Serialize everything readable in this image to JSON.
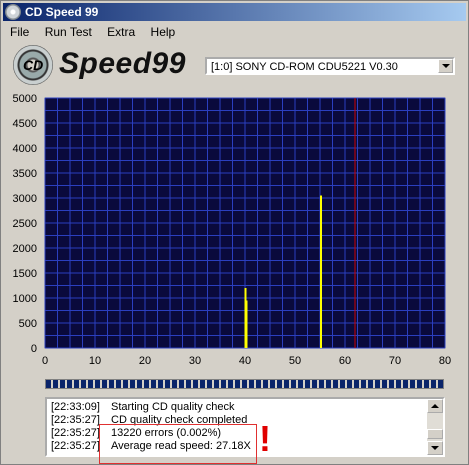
{
  "window": {
    "title": "CD Speed 99"
  },
  "menu": {
    "items": [
      "File",
      "Run Test",
      "Extra",
      "Help"
    ]
  },
  "logo": {
    "text": "Speed99",
    "disc_text": "CD"
  },
  "drive": {
    "selected": "[1:0]   SONY CD-ROM CDU5221 V0.30"
  },
  "chart_data": {
    "type": "bar",
    "xlim": [
      0,
      80
    ],
    "ylim": [
      0,
      5000
    ],
    "xticks": [
      0,
      10,
      20,
      30,
      40,
      50,
      60,
      70,
      80
    ],
    "yticks": [
      0,
      500,
      1000,
      1500,
      2000,
      2500,
      3000,
      3500,
      4000,
      4500,
      5000
    ],
    "grid": true,
    "background": "#0a0a3c",
    "grid_color": "#2b3fbf",
    "series": [
      {
        "x": [
          40.1,
          40.3,
          55.2
        ],
        "values": [
          1200,
          950,
          3050
        ],
        "color": "#ffff00"
      }
    ],
    "marker": {
      "x": 62,
      "color": "#cc0000"
    }
  },
  "log": {
    "entries": [
      {
        "time": "[22:33:09]",
        "text": "Starting CD quality check"
      },
      {
        "time": "[22:35:27]",
        "text": "CD quality check completed"
      },
      {
        "time": "[22:35:27]",
        "text": "13220 errors (0.002%)"
      },
      {
        "time": "[22:35:27]",
        "text": "Average read speed: 27.18X"
      }
    ]
  },
  "annotation": {
    "mark": "!"
  }
}
